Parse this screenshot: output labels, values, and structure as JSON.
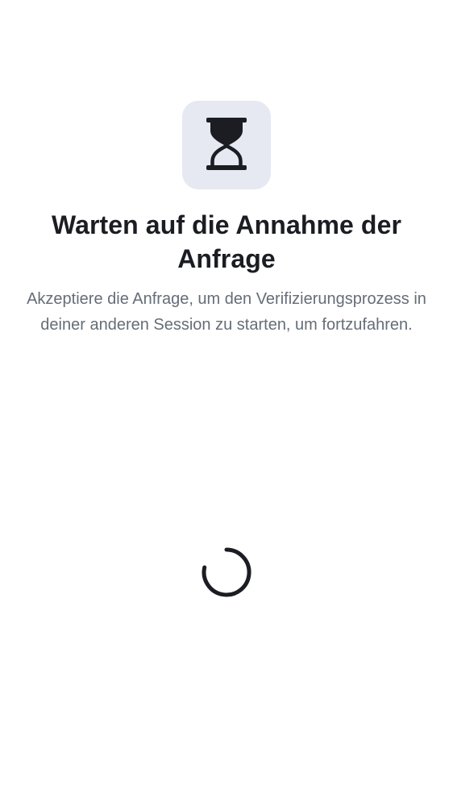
{
  "verification": {
    "icon": "hourglass-icon",
    "title": "Warten auf die Annahme der Anfrage",
    "subtitle": "Akzeptiere die Anfrage, um den Verifizierungsprozess in deiner anderen Session zu starten, um fortzufahren.",
    "loading_indicator": "spinner-icon"
  },
  "colors": {
    "background": "#ffffff",
    "icon_tile": "#e6e9f2",
    "icon": "#1b1d22",
    "title": "#1b1d22",
    "subtitle": "#656d77",
    "spinner": "#1b1d22"
  }
}
